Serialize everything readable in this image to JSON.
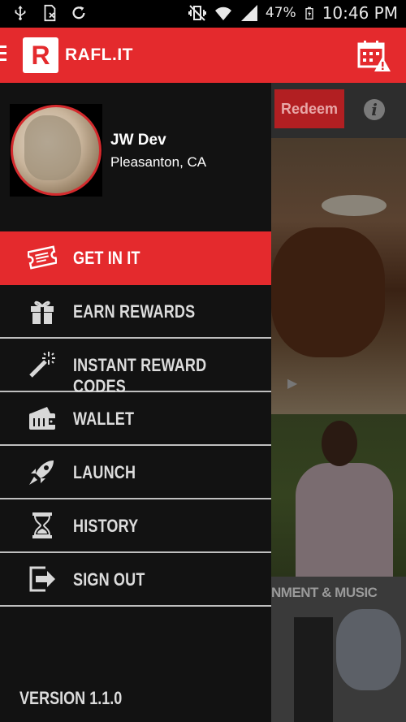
{
  "status_bar": {
    "icons_left": [
      "usb-icon",
      "sim-icon",
      "sync-icon"
    ],
    "icons_right": [
      "vibrate-icon",
      "wifi-icon",
      "signal-icon",
      "battery-icon"
    ],
    "battery_percent": "47%",
    "time": "10:46 PM"
  },
  "app_bar": {
    "logo_letter": "R",
    "title": "RAFL.IT",
    "calendar_alert_icon": "calendar-alert-icon"
  },
  "background": {
    "redeem_label": "Redeem",
    "info_label": "i",
    "music_section_label": "NMENT & MUSIC"
  },
  "drawer": {
    "user": {
      "name": "JW Dev",
      "location": "Pleasanton, CA"
    },
    "menu": [
      {
        "label": "GET IN IT",
        "icon": "ticket-icon",
        "active": true
      },
      {
        "label": "EARN REWARDS",
        "icon": "gift-icon",
        "active": false
      },
      {
        "label": "INSTANT REWARD CODES",
        "icon": "magic-wand-icon",
        "active": false
      },
      {
        "label": "WALLET",
        "icon": "wallet-icon",
        "active": false
      },
      {
        "label": "LAUNCH",
        "icon": "rocket-icon",
        "active": false
      },
      {
        "label": "HISTORY",
        "icon": "hourglass-icon",
        "active": false
      },
      {
        "label": "SIGN OUT",
        "icon": "sign-out-icon",
        "active": false
      }
    ],
    "version": "VERSION 1.1.0"
  },
  "colors": {
    "brand_red": "#e42a2d",
    "drawer_bg": "#121212",
    "divider": "#bfbfbf"
  }
}
